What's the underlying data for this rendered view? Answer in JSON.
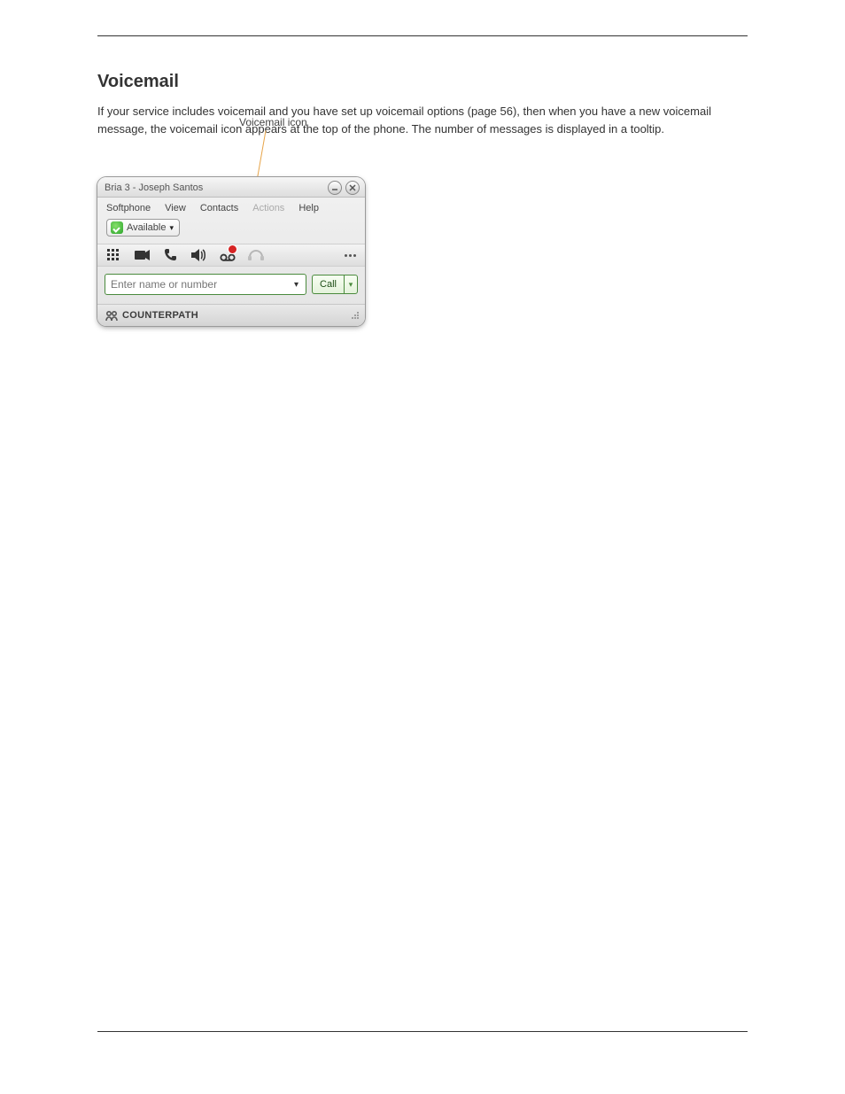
{
  "section": {
    "heading": "Voicemail",
    "paragraph": "If your service includes voicemail and you have set up voicemail options (page 56), then when you have a new voicemail message, the voicemail icon appears at the top of the phone. The number of messages is displayed in a tooltip."
  },
  "annotation": {
    "label": "Voicemail icon"
  },
  "window": {
    "title": "Bria 3 - Joseph Santos"
  },
  "menu": [
    "Softphone",
    "View",
    "Contacts",
    "Actions",
    "Help"
  ],
  "presence": {
    "label": "Available"
  },
  "dial": {
    "placeholder": "Enter name or number",
    "call_label": "Call"
  },
  "footer": {
    "brand": "CounterPath"
  }
}
